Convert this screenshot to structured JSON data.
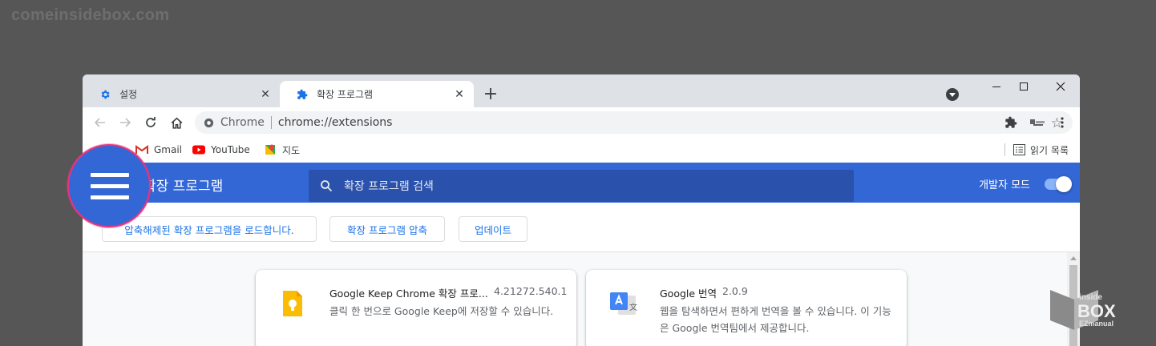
{
  "watermark": {
    "text": "comeinsidebox.com"
  },
  "tabs": [
    {
      "label": "설정",
      "icon": "gear-icon",
      "active": false
    },
    {
      "label": "확장 프로그램",
      "icon": "puzzle-icon",
      "active": true
    }
  ],
  "toolbar": {
    "omnibox_site": "Chrome",
    "omnibox_url": "chrome://extensions"
  },
  "bookmarks": {
    "items": [
      {
        "label": "Gmail",
        "icon": "gmail-icon"
      },
      {
        "label": "YouTube",
        "icon": "youtube-icon"
      },
      {
        "label": "지도",
        "icon": "maps-icon"
      }
    ],
    "reading_list": "읽기 목록"
  },
  "extensions_page": {
    "title": "확장 프로그램",
    "search_placeholder": "확장 프로그램 검색",
    "dev_mode_label": "개발자 모드",
    "dev_mode_on": true,
    "buttons": {
      "load_unpacked": "압축해제된 확장 프로그램을 로드합니다.",
      "pack": "확장 프로그램 압축",
      "update": "업데이트"
    },
    "cards": [
      {
        "name": "Google Keep Chrome 확장 프로...",
        "version": "4.21272.540.1",
        "description": "클릭 한 번으로 Google Keep에 저장할 수 있습니다.",
        "icon": "google-keep-icon"
      },
      {
        "name": "Google 번역",
        "version": "2.0.9",
        "description": "웹을 탐색하면서 편하게 번역을 볼 수 있습니다. 이 기능은 Google 번역팀에서 제공합니다.",
        "icon": "google-translate-icon"
      }
    ]
  },
  "logo": {
    "line1": "inside",
    "line2": "BOX",
    "line3": "EZmanual"
  },
  "colors": {
    "header_blue": "#3367d6",
    "search_blue": "#2a52ad",
    "highlight_ring": "#e8337f",
    "button_text": "#1a73e8"
  }
}
